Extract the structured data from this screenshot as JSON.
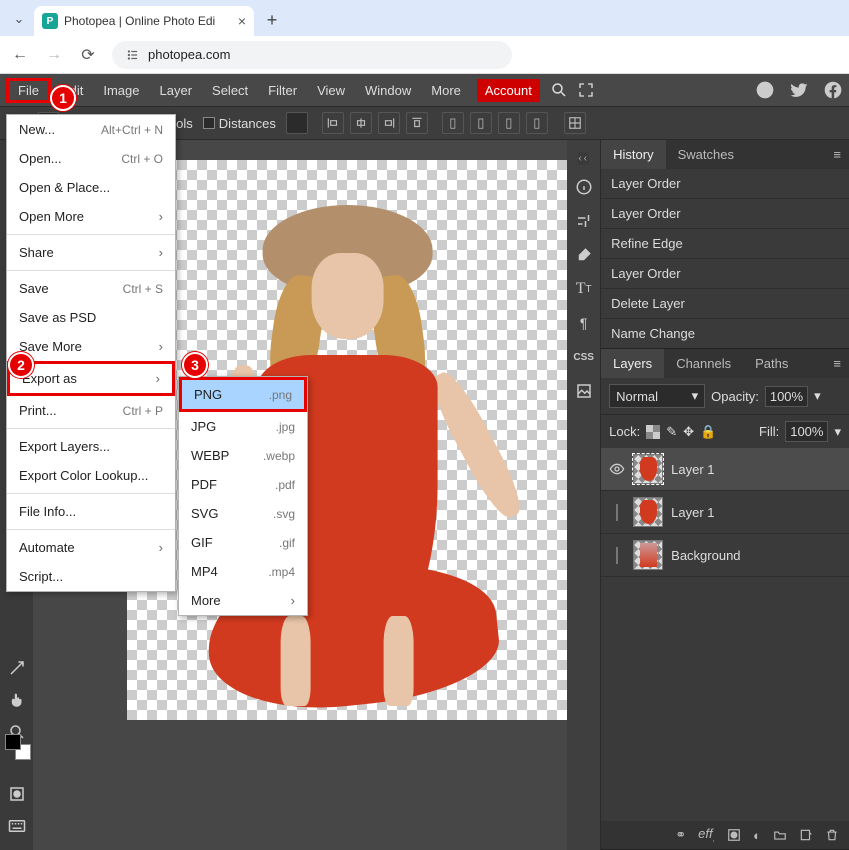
{
  "browser": {
    "tab_title": "Photopea | Online Photo Edi",
    "url": "photopea.com"
  },
  "menubar": {
    "items": [
      "File",
      "Edit",
      "Image",
      "Layer",
      "Select",
      "Filter",
      "View",
      "Window",
      "More"
    ],
    "account": "Account"
  },
  "optbar": {
    "transform": "Transform controls",
    "distances": "Distances"
  },
  "file_menu": [
    {
      "label": "New...",
      "shortcut": "Alt+Ctrl + N"
    },
    {
      "label": "Open...",
      "shortcut": "Ctrl + O"
    },
    {
      "label": "Open & Place..."
    },
    {
      "label": "Open More",
      "arrow": true
    },
    {
      "sep": true
    },
    {
      "label": "Share",
      "arrow": true
    },
    {
      "sep": true
    },
    {
      "label": "Save",
      "shortcut": "Ctrl + S"
    },
    {
      "label": "Save as PSD"
    },
    {
      "label": "Save More",
      "arrow": true
    },
    {
      "label": "Export as",
      "arrow": true,
      "boxed": true
    },
    {
      "label": "Print...",
      "shortcut": "Ctrl + P"
    },
    {
      "sep": true
    },
    {
      "label": "Export Layers..."
    },
    {
      "label": "Export Color Lookup..."
    },
    {
      "sep": true
    },
    {
      "label": "File Info..."
    },
    {
      "sep": true
    },
    {
      "label": "Automate",
      "arrow": true
    },
    {
      "label": "Script..."
    }
  ],
  "export_menu": [
    {
      "label": "PNG",
      "ext": ".png",
      "highlight": true,
      "boxed": true
    },
    {
      "label": "JPG",
      "ext": ".jpg"
    },
    {
      "label": "WEBP",
      "ext": ".webp"
    },
    {
      "label": "PDF",
      "ext": ".pdf"
    },
    {
      "label": "SVG",
      "ext": ".svg"
    },
    {
      "label": "GIF",
      "ext": ".gif"
    },
    {
      "label": "MP4",
      "ext": ".mp4"
    },
    {
      "label": "More",
      "arrow": true
    }
  ],
  "annotations": {
    "a1": "1",
    "a2": "2",
    "a3": "3"
  },
  "history": {
    "tabs": [
      "History",
      "Swatches"
    ],
    "items": [
      "Layer Order",
      "Layer Order",
      "Refine Edge",
      "Layer Order",
      "Delete Layer",
      "Name Change"
    ]
  },
  "layers": {
    "tabs": [
      "Layers",
      "Channels",
      "Paths"
    ],
    "blend": "Normal",
    "opacity_label": "Opacity:",
    "opacity_value": "100%",
    "lock_label": "Lock:",
    "fill_label": "Fill:",
    "fill_value": "100%",
    "items": [
      {
        "name": "Layer 1",
        "visible": true,
        "active": true
      },
      {
        "name": "Layer 1",
        "visible": false
      },
      {
        "name": "Background",
        "visible": false,
        "bg": true
      }
    ]
  },
  "status_icons": [
    "∞",
    "eff",
    "◐",
    "◑",
    "▭",
    "▯",
    "🗑"
  ]
}
